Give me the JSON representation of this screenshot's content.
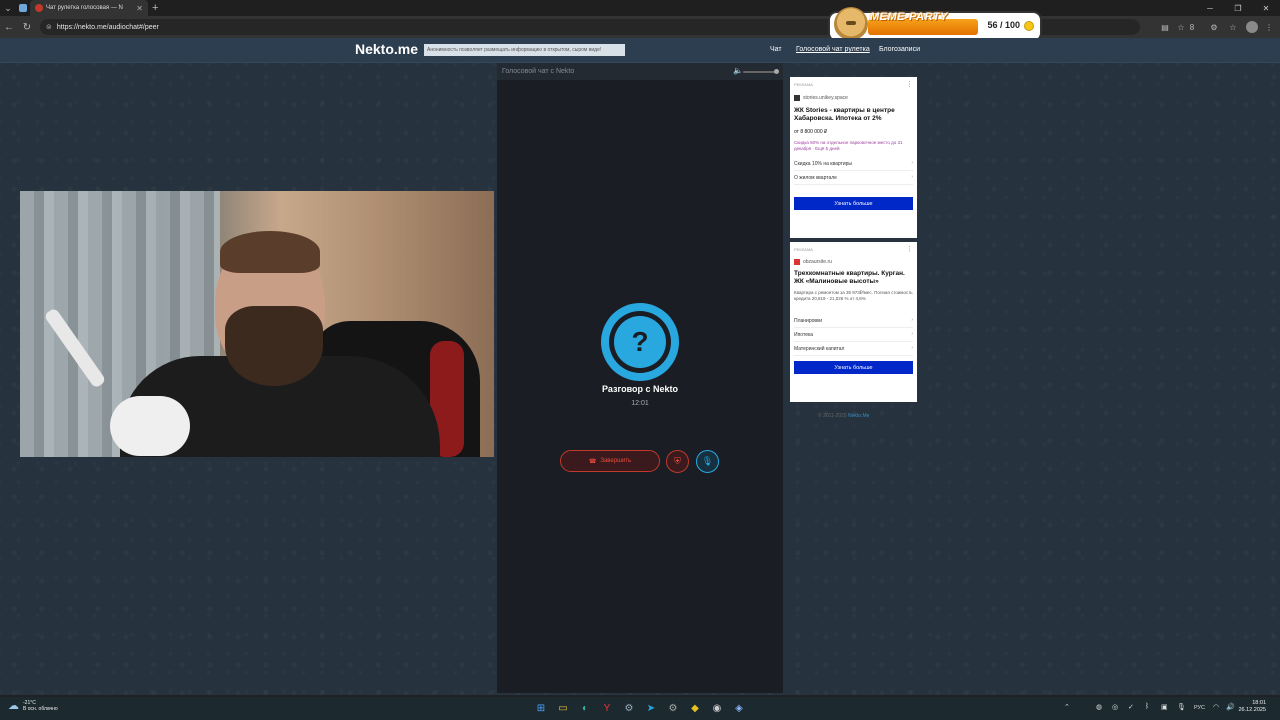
{
  "browser": {
    "tabs": [
      {
        "label": "Чат рулетка голосовая — N",
        "active": true
      }
    ],
    "url": "https://nekto.me/audiochat#/peer",
    "extension_badge": "8"
  },
  "overlay": {
    "title": "MEME-PARTY",
    "count": "56 / 100"
  },
  "site": {
    "logo": "Nekto.me",
    "notice": "Анонимность позволяет размещать информацию в открытом, сыром виде!",
    "nav": [
      {
        "label": "Чат",
        "active": false
      },
      {
        "label": "Голосовой чат рулетка",
        "active": true
      },
      {
        "label": "Блогозаписи",
        "active": false
      }
    ]
  },
  "chat": {
    "title": "Голосовой чат с Nekto",
    "peer_name": "Разговор с Nekto",
    "timer": "12:01",
    "end_call_label": "Завершить",
    "volume_level": 1.0
  },
  "ads": [
    {
      "tag": "РЕКЛАМА",
      "source": "stories.unikey.space",
      "title": "ЖК Stories - квартиры в центре Хабаровска. Ипотека от 2%",
      "price": "от 8 800 000 ₽",
      "text": "Скидка 50% на отдельное парковочное место до 31 декабря · Ещё 5 дней",
      "rows": [
        "Скидка 10% на квартиры",
        "О жилом квартале"
      ],
      "cta": "Узнать больше"
    },
    {
      "tag": "РЕКЛАМА",
      "source": "obzaursite.ru",
      "title": "Трехкомнатные квартиры. Курган. ЖК «Малиновые высоты»",
      "text": "Квартира с ремонтом за 35 973₽/мес. Полная стоимость кредита 20,819 - 21,026 % от 4,6%",
      "rows": [
        "Планировки",
        "Ипотека",
        "Материнский капитал"
      ],
      "cta": "Узнать больше"
    }
  ],
  "ad_footer": {
    "prefix": "© 2011-2025",
    "link": "Nekto.Me"
  },
  "taskbar": {
    "weather_temp": "-21°C",
    "weather_desc": "В осн. облачно",
    "lang": "РУС",
    "time": "18:01",
    "date": "26.12.2025"
  }
}
